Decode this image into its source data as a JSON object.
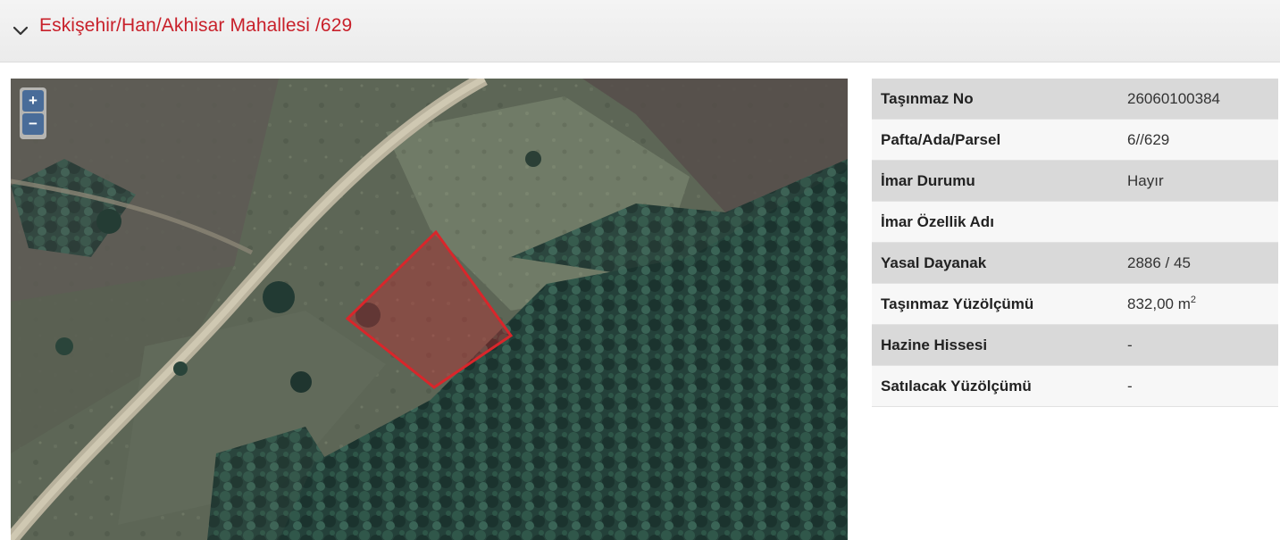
{
  "header": {
    "title": "Eskişehir/Han/Akhisar Mahallesi /629"
  },
  "map": {
    "zoom_in": "+",
    "zoom_out": "−",
    "parcel_color": "#d9262b"
  },
  "info": {
    "rows": [
      {
        "label": "Taşınmaz No",
        "value": "26060100384"
      },
      {
        "label": "Pafta/Ada/Parsel",
        "value": "6//629"
      },
      {
        "label": "İmar Durumu",
        "value": "Hayır"
      },
      {
        "label": "İmar Özellik Adı",
        "value": ""
      },
      {
        "label": "Yasal Dayanak",
        "value": "2886 / 45"
      },
      {
        "label": "Taşınmaz Yüzölçümü",
        "value": "832,00 m",
        "unit_sup": "2"
      },
      {
        "label": "Hazine Hissesi",
        "value": "-"
      },
      {
        "label": "Satılacak Yüzölçümü",
        "value": "-"
      }
    ]
  },
  "colors": {
    "title": "#c8202a",
    "row_odd": "#d9d9d9",
    "row_even": "#f7f7f7"
  }
}
